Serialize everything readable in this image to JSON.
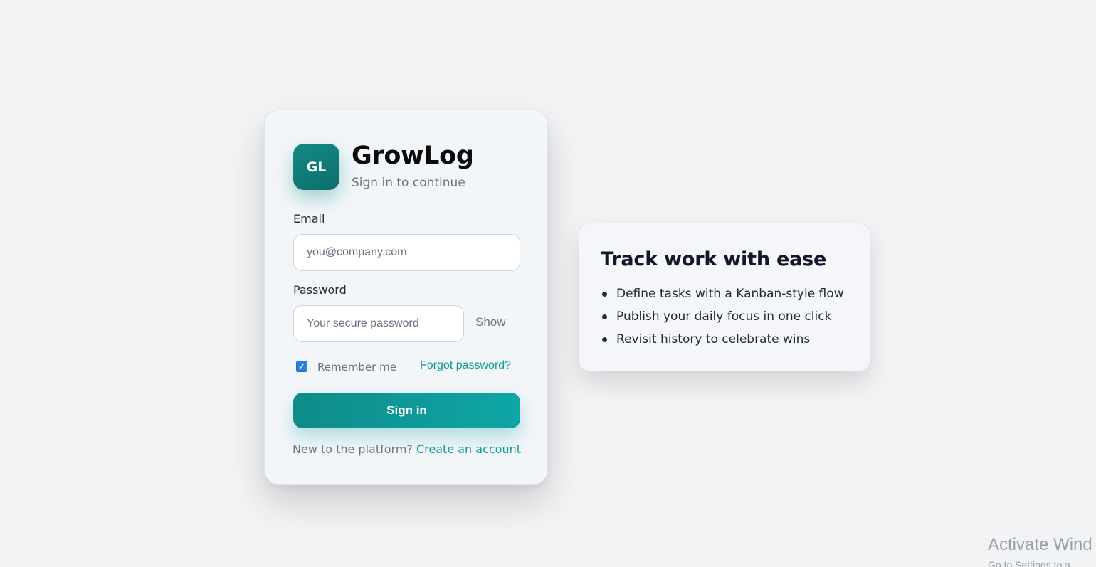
{
  "brand": {
    "logo_text": "GL",
    "title": "GrowLog",
    "subtitle": "Sign in to continue",
    "accent_color": "#0e8c89"
  },
  "form": {
    "email_label": "Email",
    "email_placeholder": "you@company.com",
    "email_value": "",
    "password_label": "Password",
    "password_placeholder": "Your secure password",
    "password_value": "",
    "show_label": "Show",
    "remember_label": "Remember me",
    "remember_checked": true,
    "forgot_label": "Forgot password?",
    "submit_label": "Sign in"
  },
  "footer": {
    "prompt": "New to the platform?",
    "create_label": "Create an account"
  },
  "info": {
    "title": "Track work with ease",
    "features": [
      "Define tasks with a Kanban-style flow",
      "Publish your daily focus in one click",
      "Revisit history to celebrate wins"
    ]
  },
  "watermark": {
    "title": "Activate Wind",
    "subtitle": "Go to Settings to a"
  }
}
